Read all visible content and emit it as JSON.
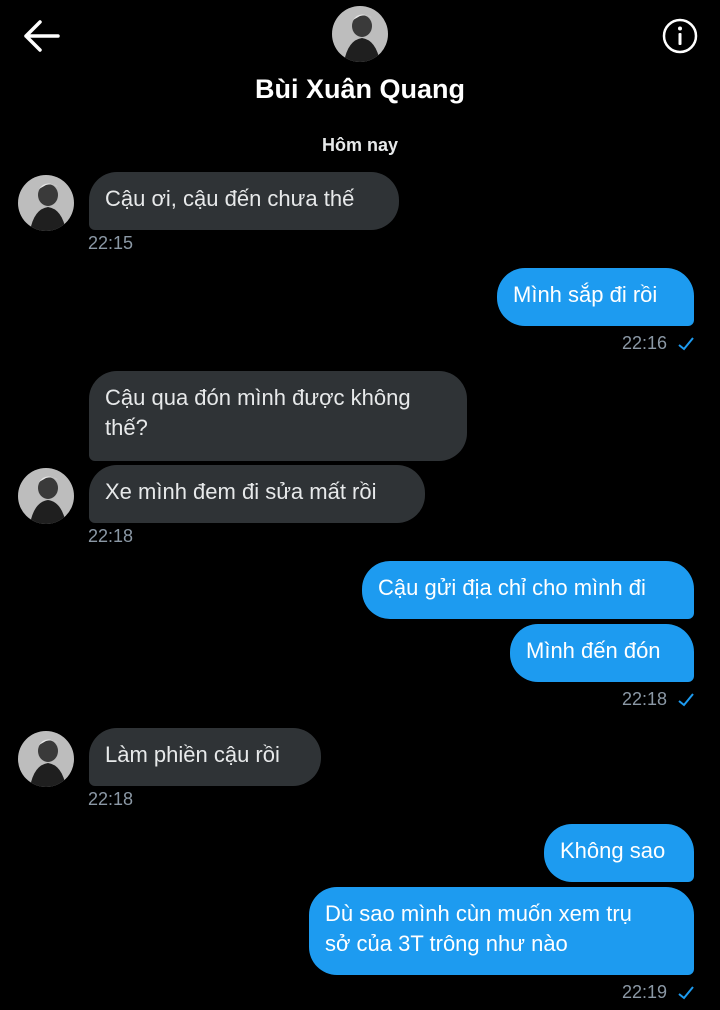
{
  "header": {
    "contact_name": "Bùi Xuân Quang",
    "back_icon": "arrow-left-icon",
    "info_icon": "info-circle-icon"
  },
  "day_separator": "Hôm nay",
  "messages": [
    {
      "from": "them",
      "text": "Cậu ơi, cậu đến chưa thế"
    },
    {
      "from": "me",
      "text": "Mình sắp đi rồi"
    },
    {
      "from": "them",
      "text_lines": [
        "Cậu qua đón mình được không",
        "thế?"
      ]
    },
    {
      "from": "them",
      "text": "Xe mình đem đi sửa mất rồi"
    },
    {
      "from": "me",
      "text": "Cậu gửi địa chỉ cho mình đi"
    },
    {
      "from": "me",
      "text": "Mình đến đón"
    },
    {
      "from": "them",
      "text": "Làm phiền cậu rồi"
    },
    {
      "from": "me",
      "text": "Không sao"
    },
    {
      "from": "me",
      "text_lines": [
        "Dù sao mình cùn muốn xem trụ",
        "sở của 3T trông như nào"
      ]
    }
  ],
  "timestamps": [
    "22:15",
    "22:16",
    "22:18",
    "22:18",
    "22:18",
    "22:19"
  ],
  "colors": {
    "background": "#000000",
    "incoming": "#2f3336",
    "outgoing": "#1d9bf0",
    "meta": "#8b98a5"
  }
}
